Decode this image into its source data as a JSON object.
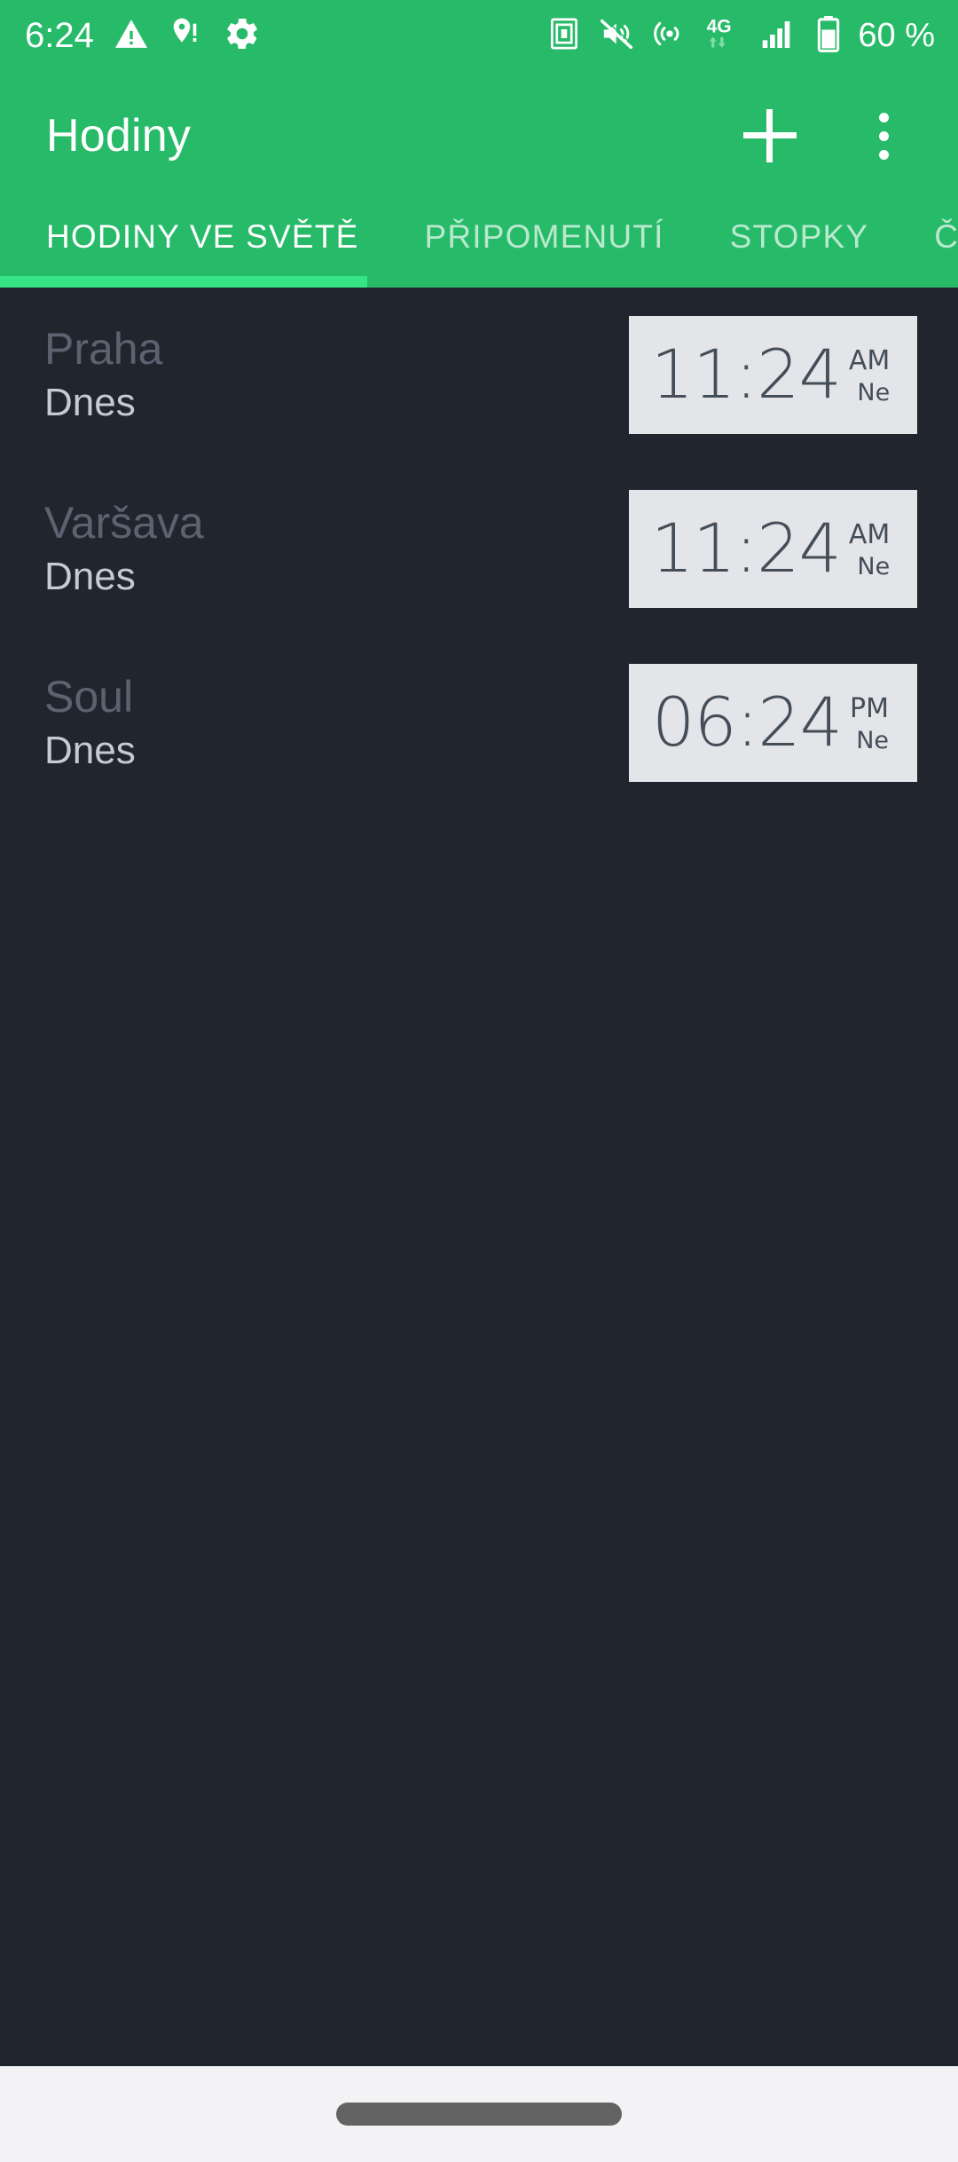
{
  "status_bar": {
    "time": "6:24",
    "battery_percent": "60 %",
    "left_icons": [
      "warning-triangle-icon",
      "location-alert-icon",
      "settings-gear-icon"
    ],
    "right_icons": [
      "screen-capture-icon",
      "volume-muted-icon",
      "hotspot-icon",
      "network-4g-icon",
      "signal-bars-icon",
      "battery-icon"
    ],
    "background_color": "#27ba68",
    "foreground_color": "#ffffff"
  },
  "app_bar": {
    "title": "Hodiny",
    "add_label": "+",
    "overflow_label": "⋮"
  },
  "tabs": {
    "active_index": 0,
    "items": [
      {
        "label": "HODINY VE SVĚTĚ"
      },
      {
        "label": "PŘIPOMENUTÍ"
      },
      {
        "label": "STOPKY"
      },
      {
        "label": "ČASOVAČ"
      }
    ],
    "indicator_color": "#35e585"
  },
  "world_clocks": {
    "rows": [
      {
        "city": "Praha",
        "day_note": "Dnes",
        "time": "11:24",
        "ampm": "AM",
        "weekday": "Ne"
      },
      {
        "city": "Varšava",
        "day_note": "Dnes",
        "time": "11:24",
        "ampm": "AM",
        "weekday": "Ne"
      },
      {
        "city": "Soul",
        "day_note": "Dnes",
        "time": "06:24",
        "ampm": "PM",
        "weekday": "Ne"
      }
    ],
    "widget_background": "#e3e5e8",
    "widget_text_color": "#454e58",
    "page_background": "#21252e"
  },
  "nav_bar": {
    "handle_name": "gesture-home-handle",
    "background_color": "#f3f3f5"
  }
}
